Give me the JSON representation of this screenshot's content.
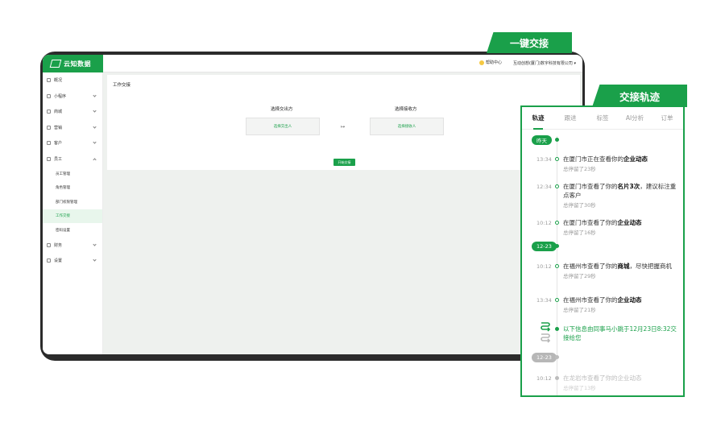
{
  "app": {
    "logo_text": "云知数据",
    "help": "帮助中心",
    "company": "互动创想(厦门)数字科技有限公司 ▾"
  },
  "sidebar": {
    "items": [
      {
        "label": "概况"
      },
      {
        "label": "小程序"
      },
      {
        "label": "商城"
      },
      {
        "label": "营销"
      },
      {
        "label": "客户"
      },
      {
        "label": "员工"
      }
    ],
    "sub_items": [
      {
        "label": "员工管理"
      },
      {
        "label": "角色管理"
      },
      {
        "label": "部门权限管理"
      },
      {
        "label": "工作交接"
      },
      {
        "label": "密码设置"
      }
    ],
    "bottom_items": [
      {
        "label": "财务"
      },
      {
        "label": "设置"
      }
    ]
  },
  "main": {
    "title": "工作交接",
    "from_label": "选择交出方",
    "from_slot": "选择交出人",
    "to_label": "选择接收方",
    "to_slot": "选择接收人",
    "start_button": "开始交接"
  },
  "callouts": {
    "exchange": "一键交接",
    "track": "交接轨迹"
  },
  "track": {
    "tabs": [
      "轨迹",
      "跟进",
      "标签",
      "AI分析",
      "订单"
    ],
    "groups": {
      "yesterday": "昨天",
      "date1": "12-23",
      "date2": "12-23"
    },
    "entries": [
      {
        "time": "13:34",
        "pre": "在厦门市正在查看你的",
        "bold": "企业动态",
        "post": "",
        "sub": "总停留了23秒"
      },
      {
        "time": "12:34",
        "pre": "在厦门市查看了你的",
        "bold": "名片3次",
        "post": "，建议标注重点客户",
        "sub": "总停留了30秒"
      },
      {
        "time": "10:12",
        "pre": "在厦门市查看了你的",
        "bold": "企业动态",
        "post": "",
        "sub": "总停留了16秒"
      },
      {
        "time": "10:12",
        "pre": "在福州市查看了你的",
        "bold": "商城",
        "post": "，尽快把握商机",
        "sub": "总停留了29秒"
      },
      {
        "time": "13:34",
        "pre": "在福州市查看了你的",
        "bold": "企业动态",
        "post": "",
        "sub": "总停留了21秒"
      },
      {
        "time": "10:12",
        "pre": "在龙岩市查看了你的企业动态",
        "bold": "",
        "post": "",
        "sub": "总停留了13秒"
      }
    ],
    "handoff_note": "以下信息由同事马小跳于12月23日8:32交接给您"
  },
  "colors": {
    "accent": "#1aa04a",
    "frame": "#2b2b2b"
  }
}
